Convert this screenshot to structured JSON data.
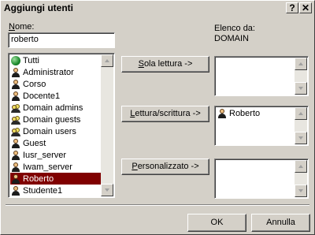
{
  "window": {
    "title": "Aggiungi utenti",
    "help_glyph": "?",
    "close_glyph": "✕"
  },
  "name_field": {
    "label_underlined": "N",
    "label_rest": "ome:",
    "value": "roberto"
  },
  "users_list": {
    "items": [
      {
        "label": "Tutti",
        "icon": "globe-icon",
        "selected": false
      },
      {
        "label": "Administrator",
        "icon": "user-icon",
        "selected": false
      },
      {
        "label": "Corso",
        "icon": "user-icon",
        "selected": false
      },
      {
        "label": "Docente1",
        "icon": "user-icon",
        "selected": false
      },
      {
        "label": "Domain admins",
        "icon": "group-icon",
        "selected": false
      },
      {
        "label": "Domain guests",
        "icon": "group-icon",
        "selected": false
      },
      {
        "label": "Domain users",
        "icon": "group-icon",
        "selected": false
      },
      {
        "label": "Guest",
        "icon": "user-icon",
        "selected": false
      },
      {
        "label": "Iusr_server",
        "icon": "user-icon",
        "selected": false
      },
      {
        "label": "Iwam_server",
        "icon": "user-icon",
        "selected": false
      },
      {
        "label": "Roberto",
        "icon": "user-icon",
        "selected": true
      },
      {
        "label": "Studente1",
        "icon": "user-icon",
        "selected": false
      }
    ]
  },
  "domain_info": {
    "label": "Elenco da:",
    "value": "DOMAIN"
  },
  "permission_buttons": {
    "read_only_u": "S",
    "read_only_rest": "ola lettura ->",
    "read_write_u": "L",
    "read_write_rest": "ettura/scrittura ->",
    "custom_u": "P",
    "custom_rest": "ersonalizzato ->"
  },
  "read_write_list": {
    "items": [
      {
        "label": "Roberto",
        "icon": "user-icon"
      }
    ]
  },
  "footer": {
    "ok_label": "OK",
    "cancel_label": "Annulla"
  }
}
